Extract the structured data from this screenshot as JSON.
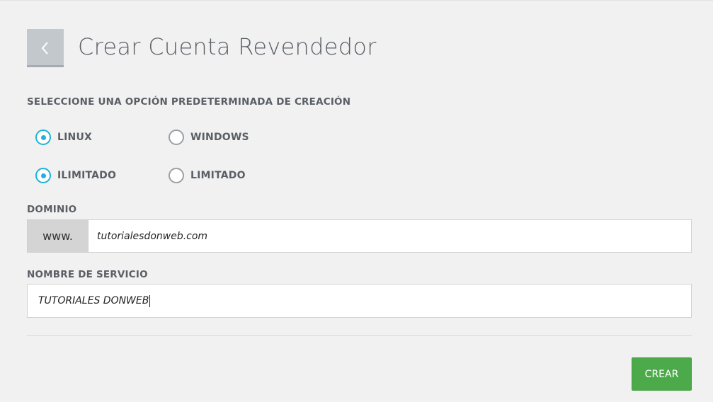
{
  "header": {
    "title": "Crear Cuenta Revendedor",
    "back_icon": "chevron-left-icon"
  },
  "options": {
    "label": "SELECCIONE UNA OPCIÓN PREDETERMINADA DE CREACIÓN",
    "os": [
      {
        "label": "LINUX",
        "checked": true
      },
      {
        "label": "WINDOWS",
        "checked": false
      }
    ],
    "plan": [
      {
        "label": "ILIMITADO",
        "checked": true
      },
      {
        "label": "LIMITADO",
        "checked": false
      }
    ]
  },
  "domain": {
    "label": "DOMINIO",
    "prefix": "www.",
    "value": "tutorialesdonweb.com"
  },
  "service": {
    "label": "NOMBRE DE SERVICIO",
    "value": "TUTORIALES DONWEB"
  },
  "actions": {
    "create_label": "CREAR"
  },
  "colors": {
    "accent": "#1fb3d9",
    "primary_button": "#4daa4b",
    "back_button": "#c3c8cd"
  }
}
